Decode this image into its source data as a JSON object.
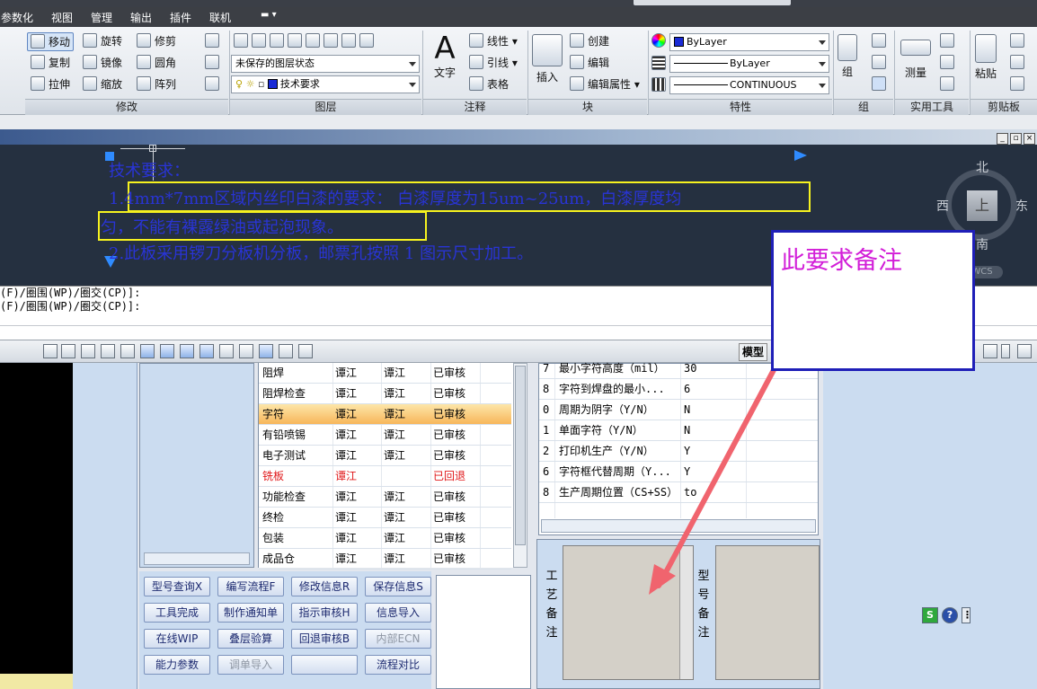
{
  "menu": [
    "参数化",
    "视图",
    "管理",
    "输出",
    "插件",
    "联机"
  ],
  "ribbon": {
    "modify": {
      "move": "移动",
      "rotate": "旋转",
      "trim": "修剪",
      "copy": "复制",
      "mirror": "镜像",
      "fillet": "圆角",
      "stretch": "拉伸",
      "scale": "缩放",
      "array": "阵列",
      "label": "修改"
    },
    "layers": {
      "state": "未保存的图层状态",
      "current": "技术要求",
      "label": "图层"
    },
    "annotation": {
      "text": "文字",
      "linear": "线性",
      "leader": "引线",
      "table": "表格",
      "label": "注释"
    },
    "block": {
      "insert": "插入",
      "create": "创建",
      "edit": "编辑",
      "edit_attr": "编辑属性",
      "label": "块"
    },
    "properties": {
      "color": "ByLayer",
      "lineweight": "ByLayer",
      "linetype": "CONTINUOUS",
      "label": "特性"
    },
    "groups": {
      "group": "组",
      "label": "组"
    },
    "utilities": {
      "measure": "测量",
      "label": "实用工具"
    },
    "clipboard": {
      "paste": "粘贴",
      "label": "剪贴板"
    }
  },
  "drawing": {
    "mtext": [
      "技术要求：",
      "1.4mm*7mm区域内丝印白漆的要求： 白漆厚度为15um~25um，白漆厚度均",
      "匀，不能有裸露绿油或起泡现象。",
      "2.此板采用锣刀分板机分板，邮票孔按照 1 图示尺寸加工。"
    ],
    "viewcube": {
      "north": "北",
      "south": "南",
      "west": "西",
      "east": "东",
      "face": "上",
      "wcs": "WCS"
    }
  },
  "command_line": [
    "(F)/圈围(WP)/圈交(CP)]:",
    "(F)/圈围(WP)/圈交(CP)]:"
  ],
  "status_bar": {
    "model_tab": "模型"
  },
  "process_table": [
    {
      "step": "阻焊",
      "a": "谭江",
      "b": "谭江",
      "status": "已审核",
      "red": false,
      "selected": false
    },
    {
      "step": "阻焊检查",
      "a": "谭江",
      "b": "谭江",
      "status": "已审核",
      "red": false,
      "selected": false
    },
    {
      "step": "字符",
      "a": "谭江",
      "b": "谭江",
      "status": "已审核",
      "red": false,
      "selected": true
    },
    {
      "step": "有铅喷锡",
      "a": "谭江",
      "b": "谭江",
      "status": "已审核",
      "red": false,
      "selected": false
    },
    {
      "step": "电子测试",
      "a": "谭江",
      "b": "谭江",
      "status": "已审核",
      "red": false,
      "selected": false
    },
    {
      "step": "铣板",
      "a": "谭江",
      "b": "",
      "status": "已回退",
      "red": true,
      "selected": false
    },
    {
      "step": "功能检查",
      "a": "谭江",
      "b": "谭江",
      "status": "已审核",
      "red": false,
      "selected": false
    },
    {
      "step": "终检",
      "a": "谭江",
      "b": "谭江",
      "status": "已审核",
      "red": false,
      "selected": false
    },
    {
      "step": "包装",
      "a": "谭江",
      "b": "谭江",
      "status": "已审核",
      "red": false,
      "selected": false
    },
    {
      "step": "成品仓",
      "a": "谭江",
      "b": "谭江",
      "status": "已审核",
      "red": false,
      "selected": false
    }
  ],
  "parameters": [
    {
      "id": "7",
      "name": "最小字符高度（mil）",
      "value": "30"
    },
    {
      "id": "8",
      "name": "字符到焊盘的最小...",
      "value": "6"
    },
    {
      "id": "0",
      "name": "周期为阴字（Y/N）",
      "value": "N"
    },
    {
      "id": "1",
      "name": "单面字符（Y/N）",
      "value": "N"
    },
    {
      "id": "2",
      "name": "打印机生产（Y/N）",
      "value": "Y"
    },
    {
      "id": "6",
      "name": "字符框代替周期（Y...",
      "value": "Y"
    },
    {
      "id": "8",
      "name": "生产周期位置（CS+SS）",
      "value": "to"
    }
  ],
  "buttons": [
    [
      "型号查询X",
      "编写流程F",
      "修改信息R",
      "保存信息S"
    ],
    [
      "工具完成",
      "制作通知单",
      "指示审核H",
      "信息导入"
    ],
    [
      "在线WIP",
      "叠层验算",
      "回退审核B",
      "内部ECN"
    ],
    [
      "能力参数",
      "调单导入",
      "",
      "流程对比"
    ]
  ],
  "buttons_disabled": [
    [
      false,
      false,
      false,
      false
    ],
    [
      false,
      false,
      false,
      false
    ],
    [
      false,
      false,
      false,
      true
    ],
    [
      false,
      true,
      false,
      false
    ]
  ],
  "remarks": {
    "process_label": "工艺备注",
    "model_label": "型号备注"
  },
  "annotation": {
    "callout": "此要求备注"
  },
  "colors": {
    "mtext": "#2934d6",
    "highlight_box": "#f6f21f",
    "callout_text": "#d21ed8",
    "callout_border": "#1f1fb8",
    "arrow": "#f0646e",
    "reject": "#e0181a"
  }
}
